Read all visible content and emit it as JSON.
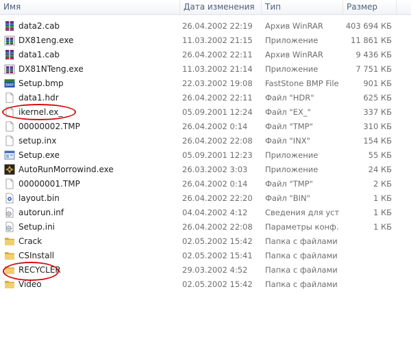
{
  "columns": {
    "name": "Имя",
    "date": "Дата изменения",
    "type": "Тип",
    "size": "Размер"
  },
  "files": [
    {
      "name": "data2.cab",
      "date": "26.04.2002 22:19",
      "type": "Архив WinRAR",
      "size": "403 694 КБ",
      "icon": "winrar-archive-icon"
    },
    {
      "name": "DX81eng.exe",
      "date": "11.03.2002 21:15",
      "type": "Приложение",
      "size": "11 861 КБ",
      "icon": "winrar-sfx-icon"
    },
    {
      "name": "data1.cab",
      "date": "26.04.2002 22:11",
      "type": "Архив WinRAR",
      "size": "9 436 КБ",
      "icon": "winrar-archive-icon"
    },
    {
      "name": "DX81NTeng.exe",
      "date": "11.03.2002 21:14",
      "type": "Приложение",
      "size": "7 751 КБ",
      "icon": "winrar-sfx-icon"
    },
    {
      "name": "Setup.bmp",
      "date": "22.03.2002 19:08",
      "type": "FastStone BMP File",
      "size": "901 КБ",
      "icon": "bmp-image-icon"
    },
    {
      "name": "data1.hdr",
      "date": "26.04.2002 22:11",
      "type": "Файл \"HDR\"",
      "size": "625 КБ",
      "icon": "blank-file-icon"
    },
    {
      "name": "ikernel.ex_",
      "date": "05.09.2001 12:24",
      "type": "Файл \"EX_\"",
      "size": "337 КБ",
      "icon": "blank-file-icon"
    },
    {
      "name": "00000002.TMP",
      "date": "26.04.2002 0:14",
      "type": "Файл \"TMP\"",
      "size": "310 КБ",
      "icon": "blank-file-icon"
    },
    {
      "name": "setup.inx",
      "date": "26.04.2002 22:08",
      "type": "Файл \"INX\"",
      "size": "154 КБ",
      "icon": "blank-file-icon"
    },
    {
      "name": "Setup.exe",
      "date": "05.09.2001 12:23",
      "type": "Приложение",
      "size": "55 КБ",
      "icon": "setup-exe-icon"
    },
    {
      "name": "AutoRunMorrowind.exe",
      "date": "26.03.2002 3:03",
      "type": "Приложение",
      "size": "24 КБ",
      "icon": "morrowind-app-icon"
    },
    {
      "name": "00000001.TMP",
      "date": "26.04.2002 0:14",
      "type": "Файл \"TMP\"",
      "size": "2 КБ",
      "icon": "blank-file-icon"
    },
    {
      "name": "layout.bin",
      "date": "26.04.2002 22:20",
      "type": "Файл \"BIN\"",
      "size": "1 КБ",
      "icon": "bin-file-icon"
    },
    {
      "name": "autorun.inf",
      "date": "04.04.2002 4:12",
      "type": "Сведения для уст...",
      "size": "1 КБ",
      "icon": "settings-file-icon"
    },
    {
      "name": "Setup.ini",
      "date": "26.04.2002 22:08",
      "type": "Параметры конф...",
      "size": "1 КБ",
      "icon": "settings-file-icon"
    },
    {
      "name": "Crack",
      "date": "02.05.2002 15:42",
      "type": "Папка с файлами",
      "size": "",
      "icon": "folder-icon"
    },
    {
      "name": "CSInstall",
      "date": "02.05.2002 15:41",
      "type": "Папка с файлами",
      "size": "",
      "icon": "folder-icon"
    },
    {
      "name": "RECYCLER",
      "date": "29.03.2002 4:52",
      "type": "Папка с файлами",
      "size": "",
      "icon": "folder-icon"
    },
    {
      "name": "Video",
      "date": "02.05.2002 15:42",
      "type": "Папка с файлами",
      "size": "",
      "icon": "folder-icon"
    }
  ],
  "highlighted": [
    "ikernel.ex_",
    "RECYCLER"
  ],
  "colors": {
    "header_text": "#4c607a",
    "secondary_text": "#6d6d6d",
    "highlight_circle": "#d20f0f",
    "folder": "#e8c25a"
  }
}
